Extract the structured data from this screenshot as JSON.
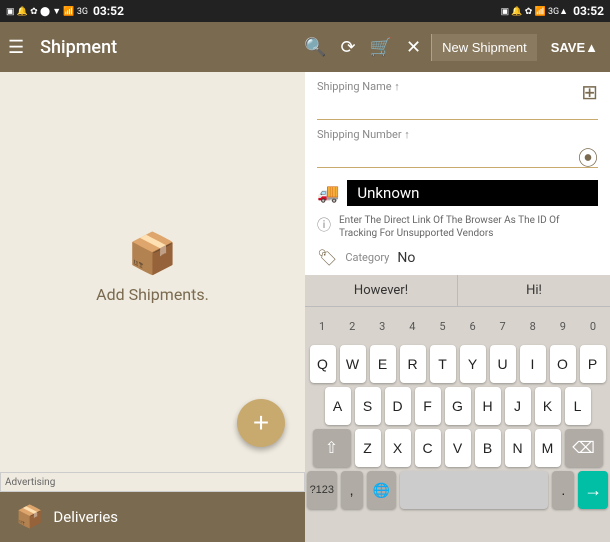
{
  "statusBar": {
    "left": "🔲 🔔 🐞 ☯ 🔒 📶 3G 03:52",
    "leftText": "03:52",
    "right": "🔲 🔔 🐞 ☯ 📶 3G▲ 03:52",
    "rightText": "03:52"
  },
  "appBar": {
    "menuIcon": "☰",
    "title": "Shipment",
    "searchIcon": "🔍",
    "historyIcon": "⟳",
    "cartIcon": "🛒",
    "closeIcon": "✕",
    "newShipmentLabel": "New Shipment",
    "saveLabel": "SAVE▲"
  },
  "leftPanel": {
    "addShipmentLabel": "Add Shipments.",
    "packageIcon": "📦",
    "fabIcon": "+",
    "advertisingLabel": "Advertising",
    "bottomNavIcon": "📦",
    "bottomNavLabel": "Deliveries"
  },
  "rightPanel": {
    "shippingNameLabel": "Shipping Name ↑",
    "shippingNamePlaceholder": "",
    "shippingNumberLabel": "Shipping Number ↑",
    "shippingNumberPlaceholder": "",
    "carrierValue": "Unknown",
    "infoText": "Enter The Direct Link Of The Browser As The ID Of Tracking For Unsupported Vendors",
    "categoryLabel": "Category",
    "categoryValue": "No"
  },
  "keyboard": {
    "suggestions": [
      "However!",
      "Hi!"
    ],
    "row1": [
      "Q",
      "W",
      "E",
      "R",
      "T",
      "Y",
      "U",
      "I",
      "O",
      "P"
    ],
    "row2": [
      "A",
      "S",
      "D",
      "F",
      "G",
      "H",
      "J",
      "K",
      "L"
    ],
    "row3": [
      "Z",
      "X",
      "C",
      "V",
      "B",
      "N",
      "M"
    ],
    "numbers": [
      "1",
      "2",
      "3",
      "4",
      "5",
      "6",
      "7",
      "8",
      "9",
      "0"
    ],
    "numLabel": "?123",
    "deleteIcon": "⌫",
    "shiftIcon": "⇧",
    "globeIcon": "🌐",
    "spaceText": "",
    "periodText": ".",
    "commaText": ",",
    "enterIcon": "→"
  }
}
